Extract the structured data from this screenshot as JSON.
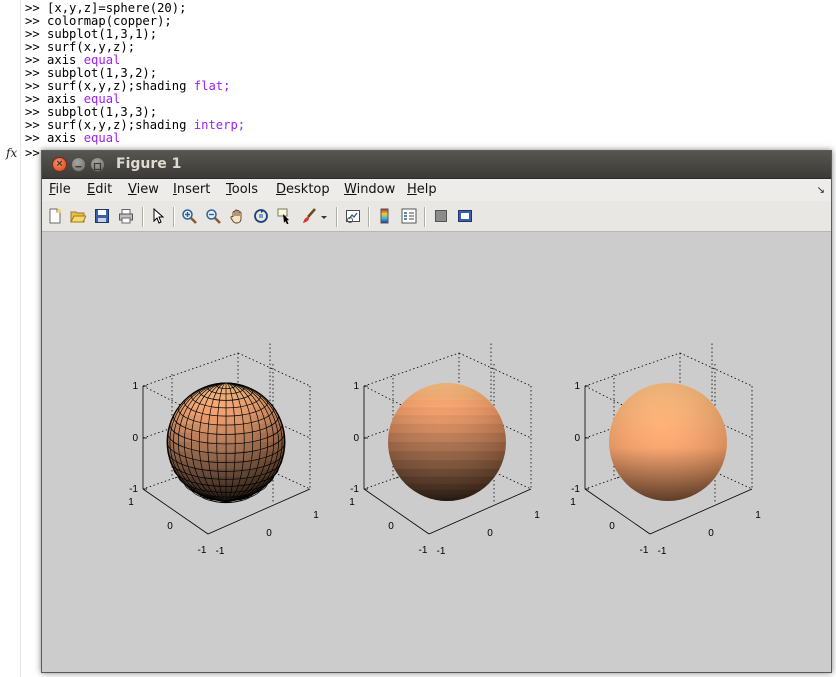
{
  "command_window": {
    "prompt": ">>",
    "lines": [
      {
        "code": "[x,y,z]=sphere(20);",
        "kw": ""
      },
      {
        "code": "colormap(copper);",
        "kw": ""
      },
      {
        "code": "subplot(1,3,1);",
        "kw": ""
      },
      {
        "code": "surf(x,y,z);",
        "kw": ""
      },
      {
        "code": "axis ",
        "kw": "equal"
      },
      {
        "code": "subplot(1,3,2);",
        "kw": ""
      },
      {
        "code": "surf(x,y,z);shading ",
        "kw": "flat;"
      },
      {
        "code": "axis ",
        "kw": "equal"
      },
      {
        "code": "subplot(1,3,3);",
        "kw": ""
      },
      {
        "code": "surf(x,y,z);shading ",
        "kw": "interp;"
      },
      {
        "code": "axis ",
        "kw": "equal"
      }
    ],
    "fx_label": "fx"
  },
  "figure": {
    "title": "Figure 1",
    "close_glyph": "×",
    "menus": [
      {
        "label": "File",
        "u": "F",
        "rest": "ile"
      },
      {
        "label": "Edit",
        "u": "E",
        "rest": "dit"
      },
      {
        "label": "View",
        "u": "V",
        "rest": "iew"
      },
      {
        "label": "Insert",
        "u": "I",
        "rest": "nsert"
      },
      {
        "label": "Tools",
        "u": "T",
        "rest": "ools"
      },
      {
        "label": "Desktop",
        "u": "D",
        "rest": "esktop"
      },
      {
        "label": "Window",
        "u": "W",
        "rest": "indow"
      },
      {
        "label": "Help",
        "u": "H",
        "rest": "elp"
      }
    ],
    "menu_overflow": "↘",
    "toolbar_icons": [
      "new-figure-icon",
      "open-file-icon",
      "save-icon",
      "print-icon",
      "pointer-icon",
      "zoom-in-icon",
      "zoom-out-icon",
      "pan-hand-icon",
      "rotate-3d-icon",
      "data-cursor-icon",
      "brush-icon",
      "brush-dropdown-icon",
      "link-plot-icon",
      "colorbar-icon",
      "legend-icon",
      "hide-plot-tools-icon",
      "show-plot-tools-icon"
    ]
  },
  "chart_data": [
    {
      "type": "surface",
      "shading": "faceted",
      "colormap": "copper",
      "z_ticks": [
        "-1",
        "0",
        "1"
      ],
      "x_ticks": [
        "-1",
        "0",
        "1"
      ],
      "y_ticks": [
        "-1",
        "0",
        "1"
      ]
    },
    {
      "type": "surface",
      "shading": "flat",
      "colormap": "copper",
      "z_ticks": [
        "-1",
        "0",
        "1"
      ],
      "x_ticks": [
        "-1",
        "0",
        "1"
      ],
      "y_ticks": [
        "-1",
        "0",
        "1"
      ]
    },
    {
      "type": "surface",
      "shading": "interp",
      "colormap": "copper",
      "z_ticks": [
        "-1",
        "0",
        "1"
      ],
      "x_ticks": [
        "-1",
        "0",
        "1"
      ],
      "y_ticks": [
        "-1",
        "0",
        "1"
      ]
    }
  ]
}
